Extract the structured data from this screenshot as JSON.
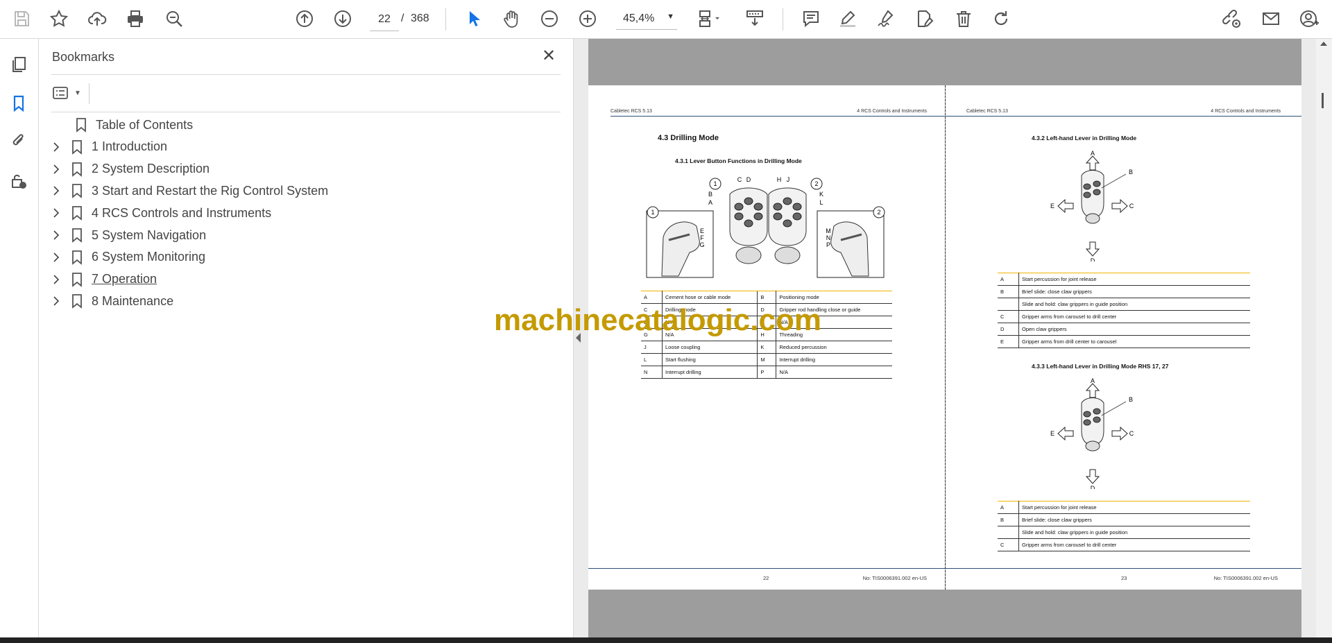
{
  "toolbar": {
    "page_current": "22",
    "page_separator": "/",
    "page_total": "368",
    "zoom": "45,4%",
    "icons": [
      "save-icon",
      "star-icon",
      "upload-icon",
      "print-icon",
      "find-icon",
      "prev-page-icon",
      "next-page-icon",
      "select-cursor-icon",
      "hand-icon",
      "zoom-out-icon",
      "zoom-in-icon",
      "page-display-icon",
      "scroll-mode-icon",
      "comment-icon",
      "highlight-icon",
      "sign-icon",
      "fill-edit-icon",
      "delete-icon",
      "rotate-icon",
      "share-link-icon",
      "email-icon",
      "account-icon"
    ]
  },
  "rail": {
    "icons": [
      "page-thumbnails-icon",
      "bookmarks-icon",
      "attachments-icon",
      "security-info-icon"
    ]
  },
  "bookmarks": {
    "title": "Bookmarks",
    "items": [
      {
        "label": "Table of Contents",
        "expandable": false,
        "underlined": false
      },
      {
        "label": "1 Introduction",
        "expandable": true,
        "underlined": false
      },
      {
        "label": "2 System Description",
        "expandable": true,
        "underlined": false
      },
      {
        "label": "3 Start and Restart the Rig Control System",
        "expandable": true,
        "underlined": false
      },
      {
        "label": "4 RCS Controls and Instruments",
        "expandable": true,
        "underlined": false
      },
      {
        "label": "5 System Navigation",
        "expandable": true,
        "underlined": false
      },
      {
        "label": "6 System Monitoring",
        "expandable": true,
        "underlined": false
      },
      {
        "label": "7 Operation",
        "expandable": true,
        "underlined": true
      },
      {
        "label": "8 Maintenance",
        "expandable": true,
        "underlined": false
      }
    ]
  },
  "document": {
    "watermark": "machinecatalogic.com",
    "left_page": {
      "header_left": "Cabletec RCS 5.13",
      "header_right": "4 RCS Controls and Instruments",
      "section_title": "4.3  Drilling Mode",
      "subsection_title": "4.3.1 Lever Button Functions in Drilling Mode",
      "figure_labels": [
        "1",
        "C",
        "D",
        "B",
        "A",
        "H",
        "J",
        "2",
        "K",
        "L",
        "1",
        "E",
        "F",
        "G",
        "2",
        "M",
        "N",
        "P"
      ],
      "table": [
        [
          "A",
          "Cement hose or cable mode",
          "B",
          "Positioning mode"
        ],
        [
          "C",
          "Drilling mode",
          "D",
          "Gripper rod handling close or guide"
        ],
        [
          "E",
          "N/A",
          "F",
          "N/A"
        ],
        [
          "G",
          "N/A",
          "H",
          "Threading"
        ],
        [
          "J",
          "Loose coupling",
          "K",
          "Reduced percussion"
        ],
        [
          "L",
          "Start flushing",
          "M",
          "Interrupt drilling"
        ],
        [
          "N",
          "Interrupt drilling",
          "P",
          "N/A"
        ]
      ],
      "footer_page": "22",
      "footer_doc": "No: TIS0006391.002 en-US"
    },
    "right_page": {
      "header_left": "Cabletec RCS 5.13",
      "header_right": "4 RCS Controls and Instruments",
      "subsection_a": "4.3.2 Left-hand Lever in Drilling Mode",
      "figure_a_labels": [
        "A",
        "B",
        "E",
        "C",
        "D"
      ],
      "table_a": [
        [
          "A",
          "Start percussion for joint release"
        ],
        [
          "B",
          "Brief slide: close claw grippers"
        ],
        [
          "",
          "Slide and hold: claw grippers in guide position"
        ],
        [
          "C",
          "Gripper arms from carousel to drill center"
        ],
        [
          "D",
          "Open claw grippers"
        ],
        [
          "E",
          "Gripper arms from drill center to carousel"
        ]
      ],
      "subsection_b": "4.3.3 Left-hand Lever in Drilling Mode RHS 17, 27",
      "figure_b_labels": [
        "A",
        "B",
        "E",
        "C",
        "D"
      ],
      "table_b": [
        [
          "A",
          "Start percussion for joint release"
        ],
        [
          "B",
          "Brief slide: close claw grippers"
        ],
        [
          "",
          "Slide and hold: claw grippers in guide position"
        ],
        [
          "C",
          "Gripper arms from carousel to drill center"
        ]
      ],
      "footer_page": "23",
      "footer_doc": "No: TIS0006391.002 en-US"
    }
  }
}
